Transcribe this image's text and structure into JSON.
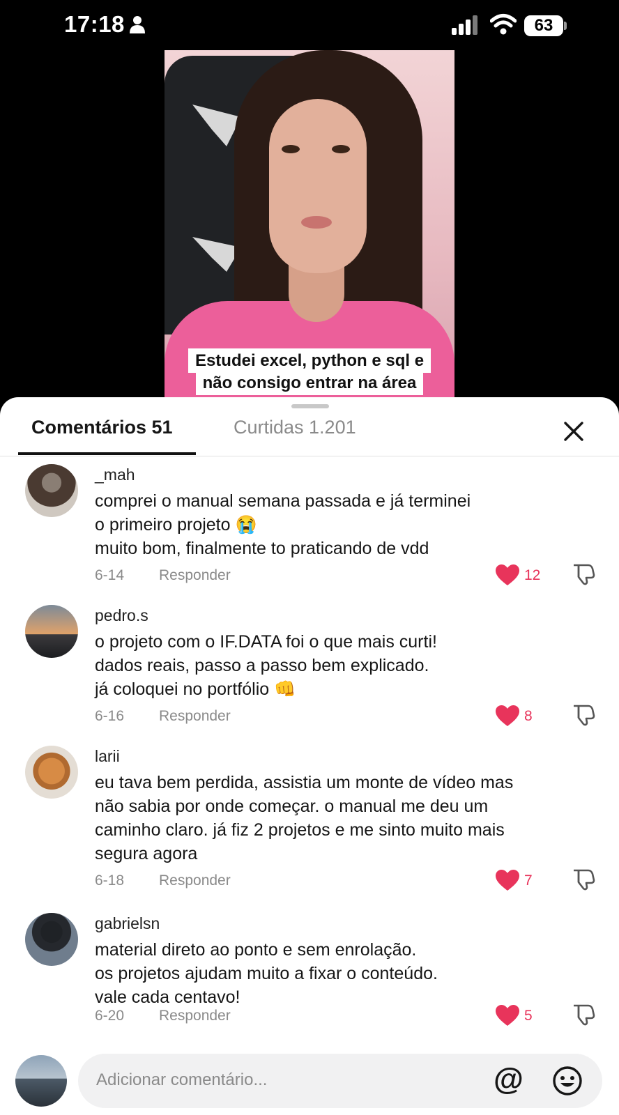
{
  "status_bar": {
    "time": "17:18",
    "battery": "63"
  },
  "video": {
    "caption_line1": "Estudei excel, python e sql e",
    "caption_line2": "não consigo entrar na área"
  },
  "tabs": {
    "comments": "Comentários 51",
    "likes": "Curtidas 1.201"
  },
  "comments": [
    {
      "username": "_mah",
      "lines": [
        "comprei o manual semana passada e já terminei",
        "o primeiro projeto 😭",
        "muito bom, finalmente to praticando de vdd"
      ],
      "date": "6-14",
      "reply": "Responder",
      "likes": "12"
    },
    {
      "username": "pedro.s",
      "lines": [
        "o projeto com o IF.DATA foi o que mais curti!",
        "dados reais, passo a passo bem explicado.",
        "já coloquei no portfólio 👊"
      ],
      "date": "6-16",
      "reply": "Responder",
      "likes": "8"
    },
    {
      "username": "larii",
      "lines": [
        "eu tava bem perdida, assistia um monte de vídeo mas",
        "não sabia por onde começar. o manual me deu um",
        "caminho claro. já fiz 2 projetos e me sinto muito mais",
        "segura agora"
      ],
      "date": "6-18",
      "reply": "Responder",
      "likes": "7"
    },
    {
      "username": "gabrielsn",
      "lines": [
        "material direto ao ponto e sem enrolação.",
        "os projetos ajudam muito a fixar o conteúdo.",
        "vale cada centavo!"
      ],
      "date": "6-20",
      "reply": "Responder",
      "likes": "5"
    }
  ],
  "input": {
    "placeholder": "Adicionar comentário...",
    "mention": "@"
  },
  "colors": {
    "like": "#e8345b",
    "muted": "#8a8a8a",
    "text": "#161616"
  },
  "icons": [
    "person-icon",
    "signal-icon",
    "wifi-icon",
    "close-icon",
    "heart-icon",
    "dislike-icon",
    "emoji-icon"
  ]
}
